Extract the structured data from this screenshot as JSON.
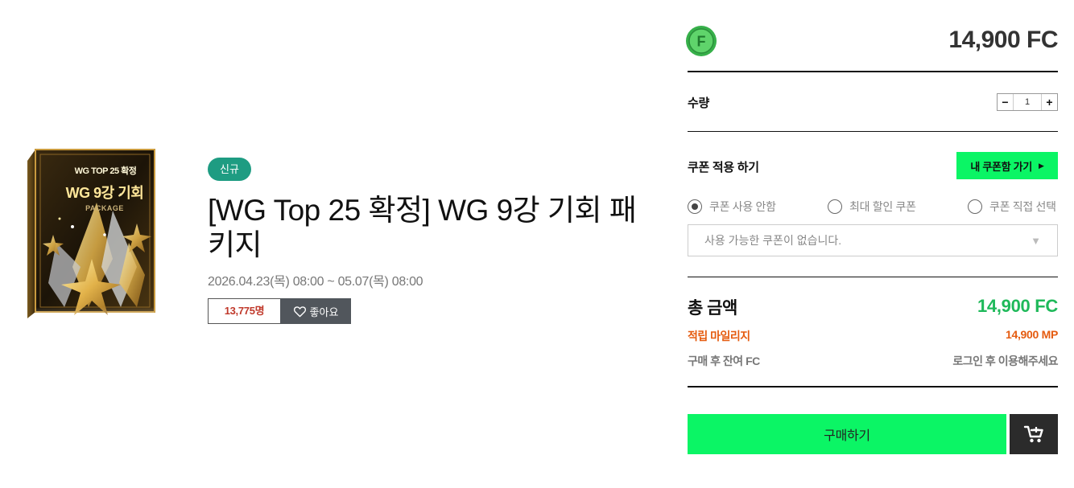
{
  "product": {
    "badge": "신규",
    "title": "[WG Top 25 확정] WG 9강 기회 패키지",
    "period": "2026.04.23(목) 08:00 ~ 05.07(목) 08:00",
    "buyer_count": "13,775명",
    "like_label": "좋아요",
    "image_text": {
      "line1": "WG TOP 25 확정",
      "line2": "WG 9강 기회",
      "line3": "PACKAGE"
    }
  },
  "purchase": {
    "coin_letter": "F",
    "price": "14,900 FC",
    "quantity_label": "수량",
    "quantity_minus": "−",
    "quantity_value": "1",
    "quantity_plus": "+",
    "coupon_label": "쿠폰 적용 하기",
    "coupon_box_button": "내 쿠폰함 가기",
    "coupon_box_arrow": "▶",
    "coupon_options": [
      {
        "label": "쿠폰 사용 안함",
        "checked": true
      },
      {
        "label": "최대 할인 쿠폰",
        "checked": false
      },
      {
        "label": "쿠폰 직접 선택",
        "checked": false
      }
    ],
    "coupon_select_value": "사용 가능한 쿠폰이 없습니다.",
    "coupon_select_caret": "▼",
    "total_label": "총 금액",
    "total_value": "14,900 FC",
    "mileage_label": "적립 마일리지",
    "mileage_value": "14,900 MP",
    "remaining_label": "구매 후 잔여 FC",
    "remaining_value": "로그인 후 이용해주세요",
    "buy_label": "구매하기"
  },
  "colors": {
    "accent_green": "#0bf565",
    "badge_green": "#1e9c82",
    "total_green": "#1fb95a",
    "mileage_orange": "#e55b0f",
    "buyer_count_red": "#c0392b"
  },
  "icons": {
    "coin": "fc-coin-icon",
    "heart": "heart-icon",
    "cart": "cart-icon",
    "caret": "chevron-down-icon"
  }
}
